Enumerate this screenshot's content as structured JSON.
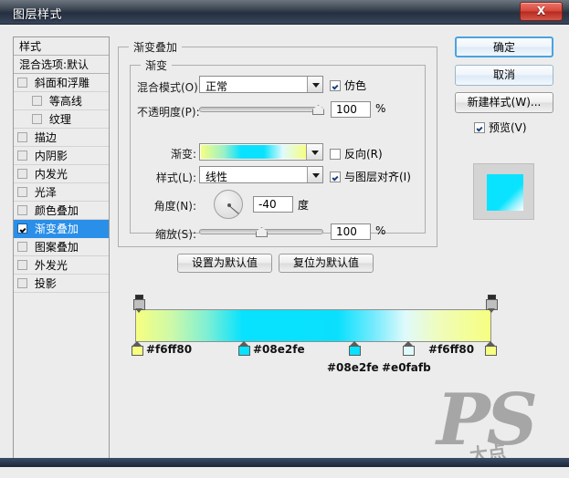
{
  "window": {
    "title": "图层样式",
    "close_label": "X"
  },
  "styles_list": {
    "header_label": "样式",
    "blending_label": "混合选项:默认",
    "items": [
      {
        "label": "斜面和浮雕",
        "checked": false,
        "sub": false,
        "selected": false
      },
      {
        "label": "等高线",
        "checked": false,
        "sub": true,
        "selected": false
      },
      {
        "label": "纹理",
        "checked": false,
        "sub": true,
        "selected": false
      },
      {
        "label": "描边",
        "checked": false,
        "sub": false,
        "selected": false
      },
      {
        "label": "内阴影",
        "checked": false,
        "sub": false,
        "selected": false
      },
      {
        "label": "内发光",
        "checked": false,
        "sub": false,
        "selected": false
      },
      {
        "label": "光泽",
        "checked": false,
        "sub": false,
        "selected": false
      },
      {
        "label": "颜色叠加",
        "checked": false,
        "sub": false,
        "selected": false
      },
      {
        "label": "渐变叠加",
        "checked": true,
        "sub": false,
        "selected": true
      },
      {
        "label": "图案叠加",
        "checked": false,
        "sub": false,
        "selected": false
      },
      {
        "label": "外发光",
        "checked": false,
        "sub": false,
        "selected": false
      },
      {
        "label": "投影",
        "checked": false,
        "sub": false,
        "selected": false
      }
    ]
  },
  "main": {
    "group_title": "渐变叠加",
    "subgroup_title": "渐变",
    "blend_mode": {
      "label": "混合模式(O):",
      "value": "正常"
    },
    "dither": {
      "label": "仿色",
      "checked": true
    },
    "opacity": {
      "label": "不透明度(P):",
      "value": "100",
      "unit": "%",
      "percent": 100
    },
    "gradient": {
      "label": "渐变:"
    },
    "reverse": {
      "label": "反向(R)",
      "checked": false
    },
    "style": {
      "label": "样式(L):",
      "value": "线性"
    },
    "align_with_layer": {
      "label": "与图层对齐(I)",
      "checked": true
    },
    "angle": {
      "label": "角度(N):",
      "value": "-40",
      "unit": "度",
      "degrees": -40
    },
    "scale": {
      "label": "缩放(S):",
      "value": "100",
      "unit": "%",
      "percent": 50
    },
    "set_default_label": "设置为默认值",
    "reset_default_label": "复位为默认值"
  },
  "actions": {
    "ok_label": "确定",
    "cancel_label": "取消",
    "new_style_label": "新建样式(W)...",
    "preview": {
      "label": "预览(V)",
      "checked": true
    }
  },
  "gradient_editor": {
    "opacity_stops": [
      {
        "position": 0,
        "color": "#2b2b2b"
      },
      {
        "position": 100,
        "color": "#2b2b2b"
      }
    ],
    "color_stops": [
      {
        "position": 0,
        "color": "#f6ff80",
        "label": "#f6ff80",
        "label_row": 1
      },
      {
        "position": 30,
        "color": "#08e2fe",
        "label": "#08e2fe",
        "label_row": 1
      },
      {
        "position": 61,
        "color": "#08e2fe",
        "label": "#08e2fe",
        "label_row": 2
      },
      {
        "position": 76,
        "color": "#e0fafb",
        "label": "#e0fafb",
        "label_row": 2
      },
      {
        "position": 100,
        "color": "#f6ff80",
        "label": "#f6ff80",
        "label_row": 1
      }
    ],
    "labels": {
      "stop1": "#f6ff80",
      "stop2": "#08e2fe",
      "stop3": "#08e2fe",
      "stop4": "#e0fafb",
      "stop5": "#f6ff80"
    }
  },
  "watermark": {
    "ps": "PS",
    "cn": "大点"
  }
}
